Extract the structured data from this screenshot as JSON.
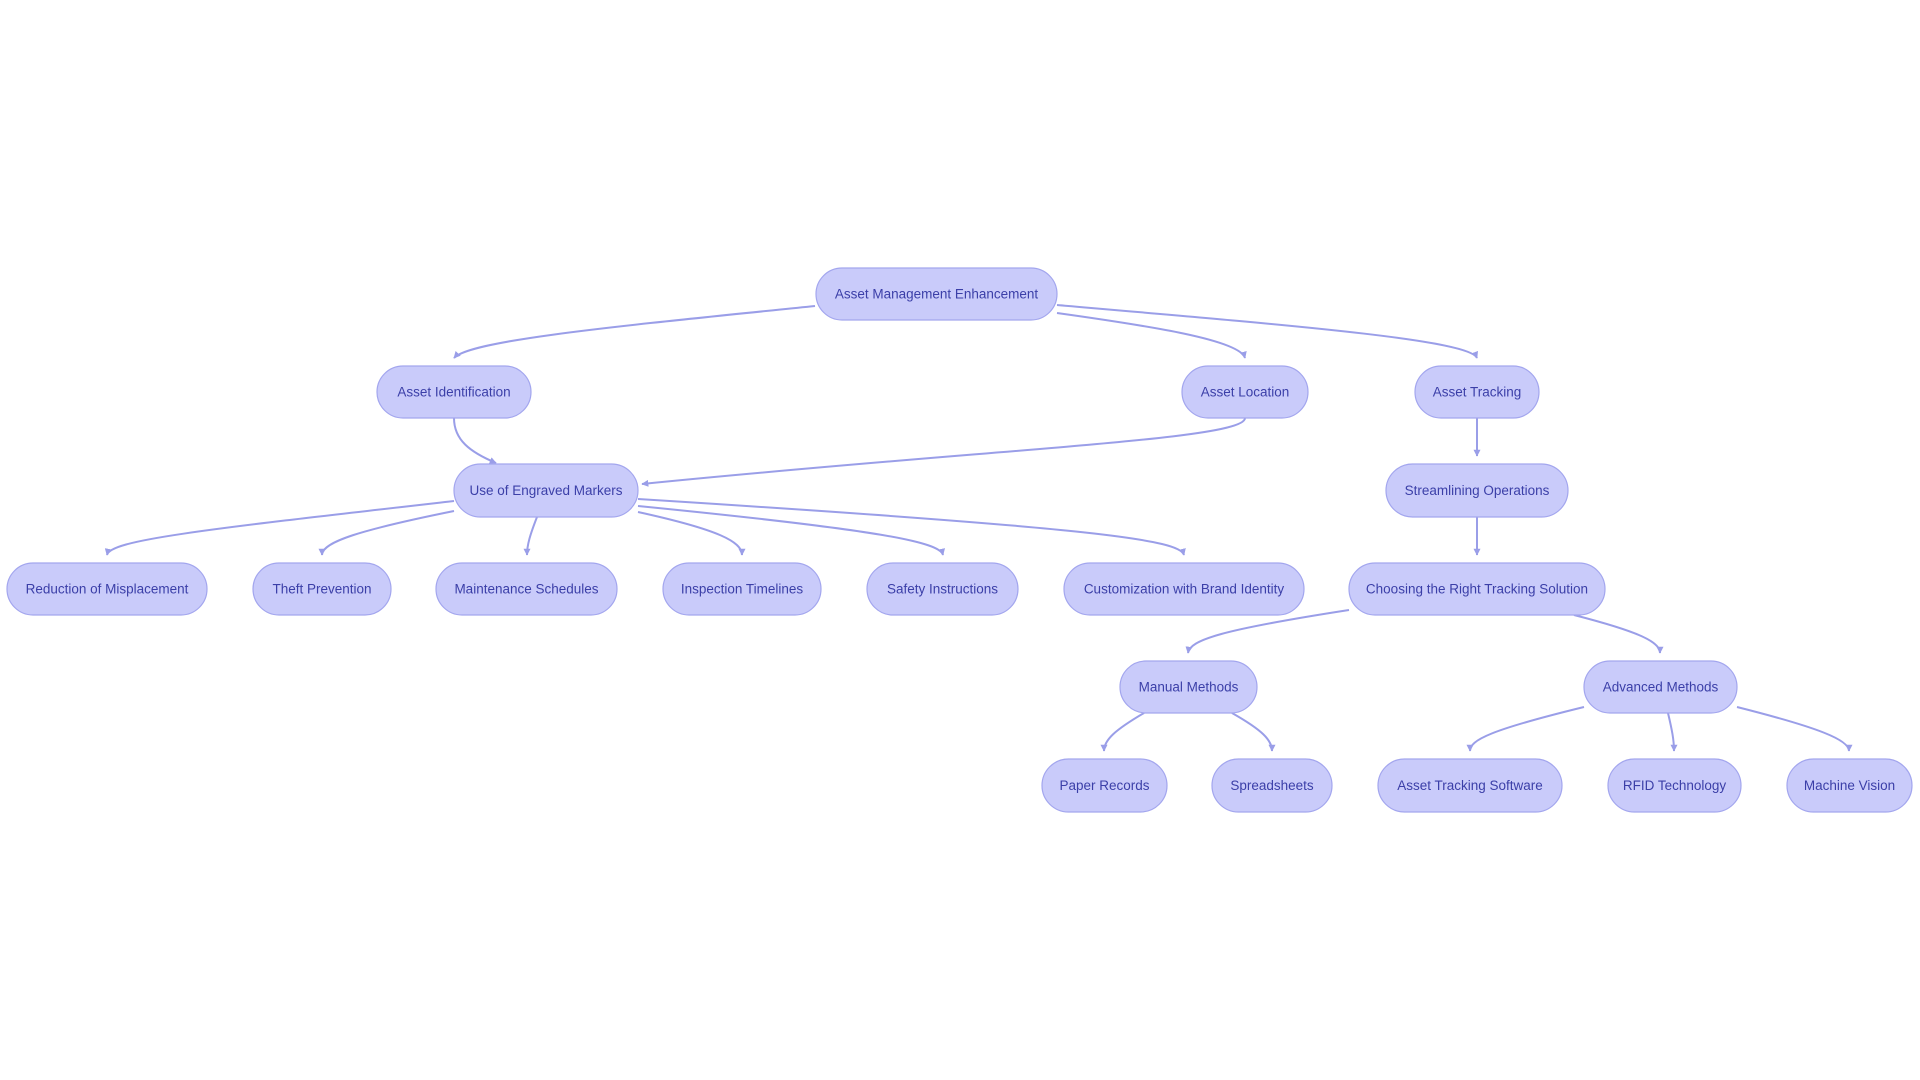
{
  "diagram": {
    "type": "flowchart",
    "direction": "top-down",
    "colors": {
      "node_fill": "#c9cbfa",
      "node_stroke": "#a3a6ee",
      "node_text": "#3b3fa8",
      "edge": "#9a9ee8",
      "background": "#ffffff"
    },
    "nodes": [
      {
        "id": "ame",
        "label": "Asset Management Enhancement"
      },
      {
        "id": "aid",
        "label": "Asset Identification"
      },
      {
        "id": "aloc",
        "label": "Asset Location"
      },
      {
        "id": "atr",
        "label": "Asset Tracking"
      },
      {
        "id": "uem",
        "label": "Use of Engraved Markers"
      },
      {
        "id": "sop",
        "label": "Streamlining Operations"
      },
      {
        "id": "rom",
        "label": "Reduction of Misplacement"
      },
      {
        "id": "thp",
        "label": "Theft Prevention"
      },
      {
        "id": "mas",
        "label": "Maintenance Schedules"
      },
      {
        "id": "int",
        "label": "Inspection Timelines"
      },
      {
        "id": "sai",
        "label": "Safety Instructions"
      },
      {
        "id": "cbi",
        "label": "Customization with Brand Identity"
      },
      {
        "id": "crt",
        "label": "Choosing the Right Tracking Solution"
      },
      {
        "id": "mam",
        "label": "Manual Methods"
      },
      {
        "id": "adm",
        "label": "Advanced Methods"
      },
      {
        "id": "par",
        "label": "Paper Records"
      },
      {
        "id": "spr",
        "label": "Spreadsheets"
      },
      {
        "id": "ats",
        "label": "Asset Tracking Software"
      },
      {
        "id": "rfid",
        "label": "RFID Technology"
      },
      {
        "id": "mav",
        "label": "Machine Vision"
      }
    ],
    "edges": [
      {
        "from": "ame",
        "to": "aid"
      },
      {
        "from": "ame",
        "to": "aloc"
      },
      {
        "from": "ame",
        "to": "atr"
      },
      {
        "from": "aid",
        "to": "uem"
      },
      {
        "from": "aloc",
        "to": "uem"
      },
      {
        "from": "atr",
        "to": "sop"
      },
      {
        "from": "uem",
        "to": "rom"
      },
      {
        "from": "uem",
        "to": "thp"
      },
      {
        "from": "uem",
        "to": "mas"
      },
      {
        "from": "uem",
        "to": "int"
      },
      {
        "from": "uem",
        "to": "sai"
      },
      {
        "from": "uem",
        "to": "cbi"
      },
      {
        "from": "sop",
        "to": "crt"
      },
      {
        "from": "crt",
        "to": "mam"
      },
      {
        "from": "crt",
        "to": "adm"
      },
      {
        "from": "mam",
        "to": "par"
      },
      {
        "from": "mam",
        "to": "spr"
      },
      {
        "from": "adm",
        "to": "ats"
      },
      {
        "from": "adm",
        "to": "rfid"
      },
      {
        "from": "adm",
        "to": "mav"
      }
    ]
  }
}
